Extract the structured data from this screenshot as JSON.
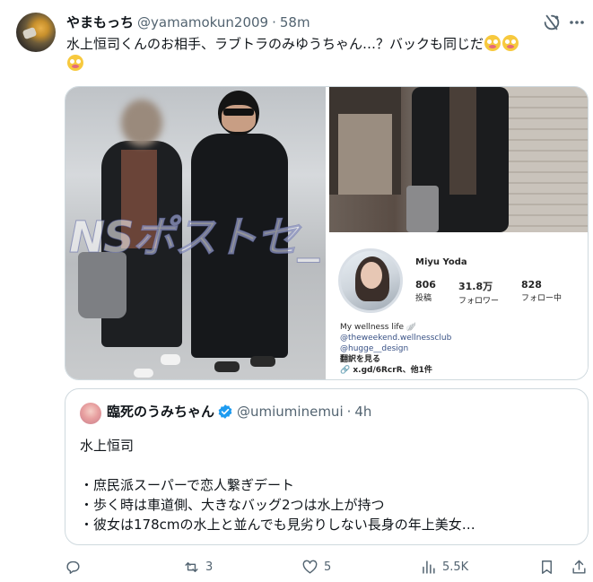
{
  "post": {
    "display_name": "やまもっち",
    "handle": "@yamamokun2009",
    "separator": "·",
    "time": "58m",
    "text": "水上恒司くんのお相手、ラブトラのみゆうちゃん…？バックも同じだ",
    "emoji_count": 3,
    "emoji": "flushed-face-emoji"
  },
  "media": {
    "watermark": "NSポストセ_",
    "instagram": {
      "name": "Miyu Yoda",
      "posts_count": "806",
      "posts_label": "投稿",
      "followers_count": "31.8万",
      "followers_label": "フォロワー",
      "following_count": "828",
      "following_label": "フォロー中",
      "bio_line": "My wellness life 🪽",
      "link1": "@theweekend.wellnessclub",
      "link2": "@hugge__design",
      "translate": "翻訳を見る",
      "url": "x.gd/6RcrR、他1件"
    }
  },
  "quote": {
    "display_name": "臨死のうみちゃん",
    "handle": "@umiuminemui",
    "separator": "·",
    "time": "4h",
    "text": "水上恒司\n\n・庶民派スーパーで恋人繋ぎデート\n・歩く時は車道側、大きなバッグ2つは水上が持つ\n・彼女は178cmの水上と並んでも見劣りしない長身の年上美女…"
  },
  "actions": {
    "reply_count": "",
    "repost_count": "3",
    "like_count": "5",
    "views_count": "5.5K"
  },
  "colors": {
    "text_primary": "#0f1419",
    "text_secondary": "#536471",
    "border": "#cfd9de",
    "verified": "#1d9bf0"
  }
}
